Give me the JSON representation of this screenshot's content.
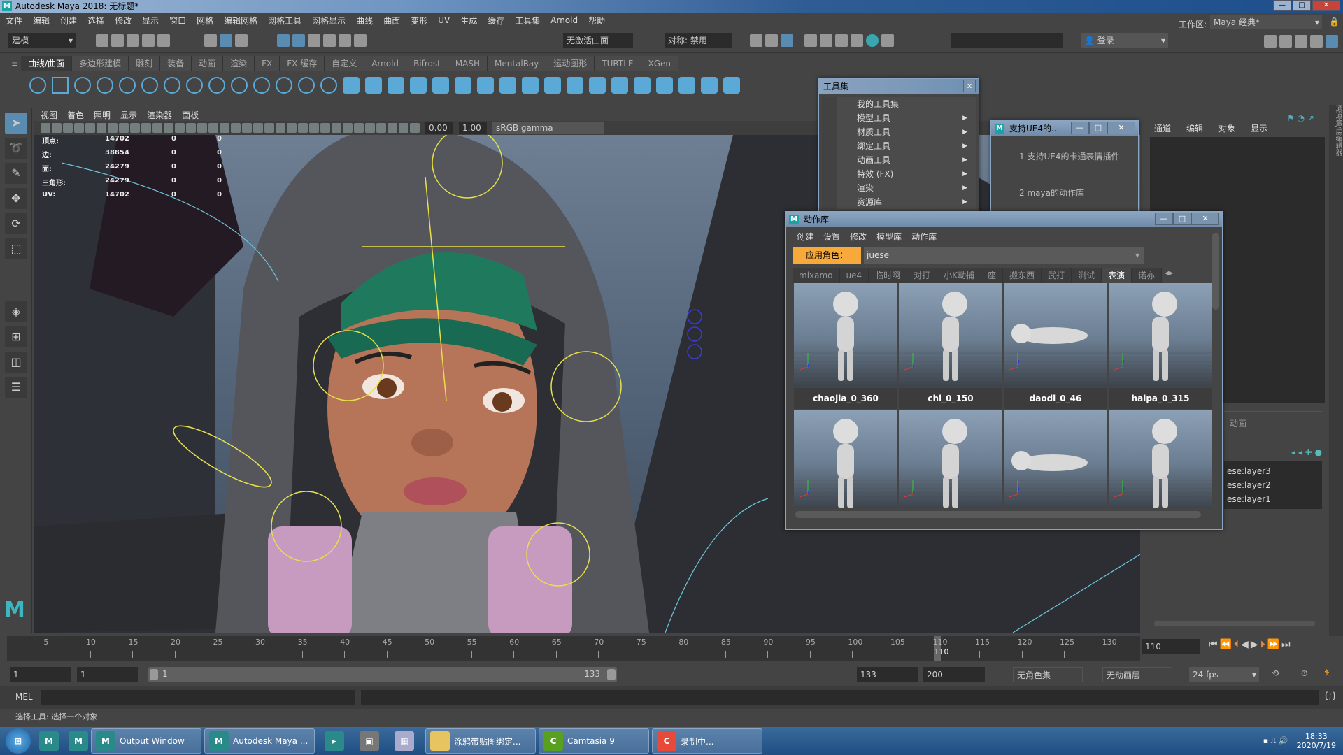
{
  "app": {
    "title": "Autodesk Maya 2018: 无标题*",
    "logo": "M"
  },
  "menubar": [
    "文件",
    "编辑",
    "创建",
    "选择",
    "修改",
    "显示",
    "窗口",
    "网格",
    "编辑网格",
    "网格工具",
    "网格显示",
    "曲线",
    "曲面",
    "变形",
    "UV",
    "生成",
    "缓存",
    "工具集",
    "Arnold",
    "帮助"
  ],
  "statusline": {
    "mode": "建模",
    "live_surface": "无激活曲面",
    "symmetry": "对称: 禁用",
    "login": "登录",
    "workspace_label": "工作区:",
    "workspace": "Maya 经典*"
  },
  "shelf": {
    "tabs": [
      "曲线/曲面",
      "多边形建模",
      "雕刻",
      "装备",
      "动画",
      "渲染",
      "FX",
      "FX 缓存",
      "自定义",
      "Arnold",
      "Bifrost",
      "MASH",
      "MentalRay",
      "运动图形",
      "TURTLE",
      "XGen"
    ],
    "active": 0
  },
  "viewport": {
    "menu": [
      "视图",
      "着色",
      "照明",
      "显示",
      "渲染器",
      "面板"
    ],
    "exposure": "0.00",
    "gamma": "1.00",
    "colorspace": "sRGB gamma",
    "hud": [
      {
        "label": "顶点:",
        "v": "14702",
        "a": "0",
        "b": "0"
      },
      {
        "label": "边:",
        "v": "38854",
        "a": "0",
        "b": "0"
      },
      {
        "label": "面:",
        "v": "24279",
        "a": "0",
        "b": "0"
      },
      {
        "label": "三角形:",
        "v": "24279",
        "a": "0",
        "b": "0"
      },
      {
        "label": "UV:",
        "v": "14702",
        "a": "0",
        "b": "0"
      }
    ]
  },
  "channelbox": {
    "tabs": [
      "通道",
      "编辑",
      "对象",
      "显示"
    ],
    "layer_tab": "动画",
    "layers": [
      "ese:layer3",
      "ese:layer2",
      "ese:layer1"
    ],
    "side_label": "通道盒/层编辑器"
  },
  "toolset": {
    "title": "工具集",
    "items": [
      {
        "label": "我的工具集",
        "sub": false
      },
      {
        "label": "模型工具",
        "sub": true
      },
      {
        "label": "材质工具",
        "sub": true
      },
      {
        "label": "绑定工具",
        "sub": true
      },
      {
        "label": "动画工具",
        "sub": true
      },
      {
        "label": "特效 (FX)",
        "sub": true
      },
      {
        "label": "渲染",
        "sub": true
      },
      {
        "label": "资源库",
        "sub": true
      }
    ]
  },
  "ue4win": {
    "title": "支持UE4的...",
    "items": [
      "1 支持UE4的卡通表情插件",
      "2 maya的动作库"
    ]
  },
  "library": {
    "title": "动作库",
    "menu": [
      "创建",
      "设置",
      "修改",
      "模型库",
      "动作库"
    ],
    "apply_label": "应用角色：",
    "character": "juese",
    "tabs": [
      "mixamo",
      "ue4",
      "临时啊",
      "对打",
      "小K动捕",
      "座",
      "搬东西",
      "武打",
      "测试",
      "表演",
      "诺亦"
    ],
    "active_tab": 9,
    "clips": [
      "chaojia_0_360",
      "chi_0_150",
      "daodi_0_46",
      "haipa_0_315"
    ],
    "accent": "#f7a93a"
  },
  "timeline": {
    "ticks": [
      5,
      10,
      15,
      20,
      25,
      30,
      35,
      40,
      45,
      50,
      55,
      60,
      65,
      70,
      75,
      80,
      85,
      90,
      95,
      100,
      105,
      110,
      115,
      120,
      125,
      130
    ],
    "current": "110",
    "current_field": "110"
  },
  "range": {
    "start": "1",
    "anim_start": "1",
    "slider_start": "1",
    "slider_end": "133",
    "end": "133",
    "anim_end": "200",
    "charset": "无角色集",
    "animlayer": "无动画层",
    "fps": "24 fps"
  },
  "mel": {
    "label": "MEL"
  },
  "help": "选择工具: 选择一个对象",
  "taskbar": {
    "items": [
      "Output Window",
      "Autodesk Maya ...",
      "涂鸦带贴图绑定...",
      "Camtasia 9",
      "录制中..."
    ],
    "time": "18:33",
    "date": "2020/7/19"
  }
}
